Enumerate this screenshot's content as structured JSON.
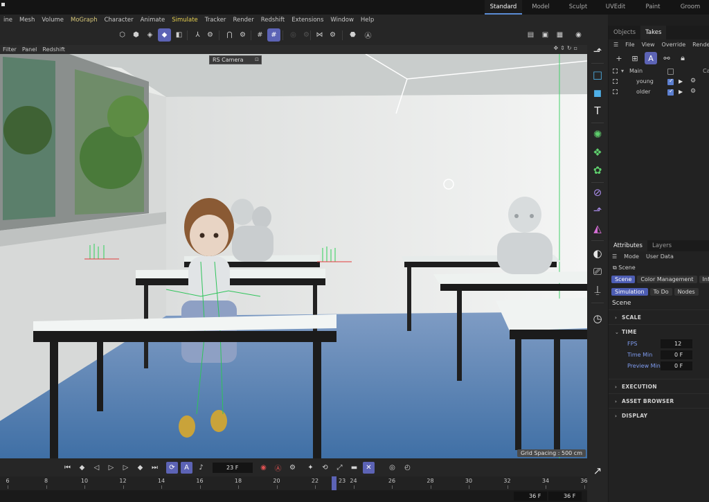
{
  "menu": [
    "ine",
    "Mesh",
    "Volume",
    "MoGraph",
    "Character",
    "Animate",
    "Simulate",
    "Tracker",
    "Render",
    "Redshift",
    "Extensions",
    "Window",
    "Help"
  ],
  "layouts": {
    "items": [
      "Standard",
      "Model",
      "Sculpt",
      "UVEdit",
      "Paint",
      "Groom"
    ],
    "active": "Standard"
  },
  "viewport": {
    "menu": [
      "Filter",
      "Panel",
      "Redshift"
    ],
    "camera": "RS Camera",
    "grid_spacing": "Grid Spacing : 500 cm"
  },
  "objects_panel": {
    "tabs": [
      "Objects",
      "Takes"
    ],
    "active_tab": "Takes",
    "menu": [
      "File",
      "View",
      "Override",
      "Render"
    ],
    "column_cut": "Ca",
    "takes": [
      {
        "name": "Main",
        "checked": false
      },
      {
        "name": "young",
        "checked": true
      },
      {
        "name": "older",
        "checked": true
      }
    ]
  },
  "attributes_panel": {
    "tabs": [
      "Attributes",
      "Layers"
    ],
    "active_tab": "Attributes",
    "menu": [
      "Mode",
      "User Data"
    ],
    "object_label": "Scene",
    "chips_row1": [
      "Scene",
      "Color Management",
      "Info"
    ],
    "chips_row2": [
      "Simulation",
      "To Do",
      "Nodes"
    ],
    "title": "Scene",
    "sections": {
      "scale": "SCALE",
      "time": "TIME",
      "execution": "EXECUTION",
      "asset_browser": "ASSET BROWSER",
      "display": "DISPLAY"
    },
    "time_fields": [
      {
        "label": "FPS",
        "value": "12"
      },
      {
        "label": "Time Min",
        "value": "0 F"
      },
      {
        "label": "Preview Min",
        "value": "0 F"
      }
    ]
  },
  "timeline": {
    "current_frame": "23 F",
    "ticks": [
      "6",
      "8",
      "10",
      "12",
      "14",
      "16",
      "18",
      "20",
      "22",
      "24",
      "26",
      "28",
      "30",
      "32",
      "34",
      "36"
    ],
    "playhead_label": "23",
    "end_frame": "36 F",
    "preview_end": "36 F"
  },
  "colors": {
    "accent": "#5c63b5",
    "simulate_menu": "#e7d04f",
    "attribute_label": "#7f9cf0"
  }
}
